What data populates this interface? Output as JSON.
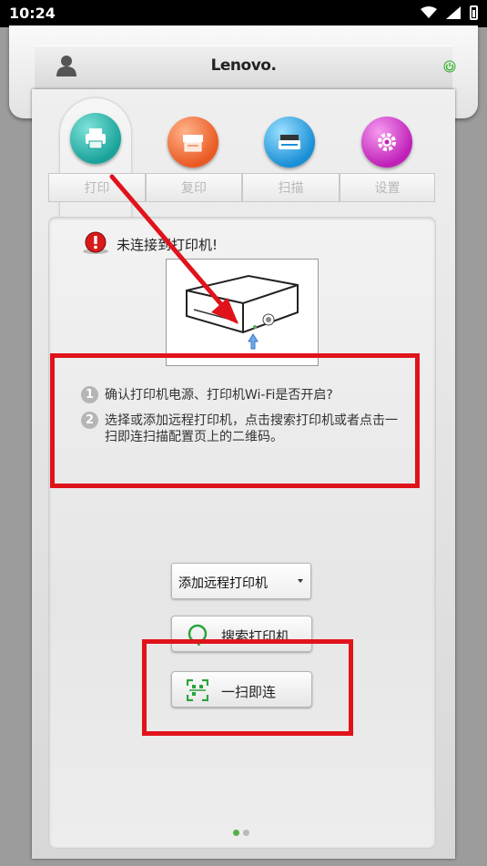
{
  "status_bar": {
    "time": "10:24"
  },
  "header": {
    "brand": "Lenovo."
  },
  "tabs": [
    {
      "label": "打印",
      "color": "#1aa39a",
      "active": true
    },
    {
      "label": "复印",
      "color": "#ea5a23",
      "active": false
    },
    {
      "label": "扫描",
      "color": "#1a8fd6",
      "active": false
    },
    {
      "label": "设置",
      "color": "#c020b8",
      "active": false
    }
  ],
  "status": {
    "message": "未连接到打印机!"
  },
  "hints": [
    {
      "num": "1",
      "line1": "确认打印机电源、打印机Wi-Fi是否开启?",
      "line2": ""
    },
    {
      "num": "2",
      "line1": "选择或添加远程打印机，点击搜索打印机或者点击一",
      "line2": "扫即连扫描配置页上的二维码。"
    }
  ],
  "controls": {
    "dropdown_selected": "添加远程打印机",
    "search_label": "搜索打印机",
    "scan_label": "一扫即连"
  },
  "colors": {
    "accent_red": "#e0131b",
    "dot_active": "#55b04a",
    "dot_inactive": "#b9b9b9"
  }
}
